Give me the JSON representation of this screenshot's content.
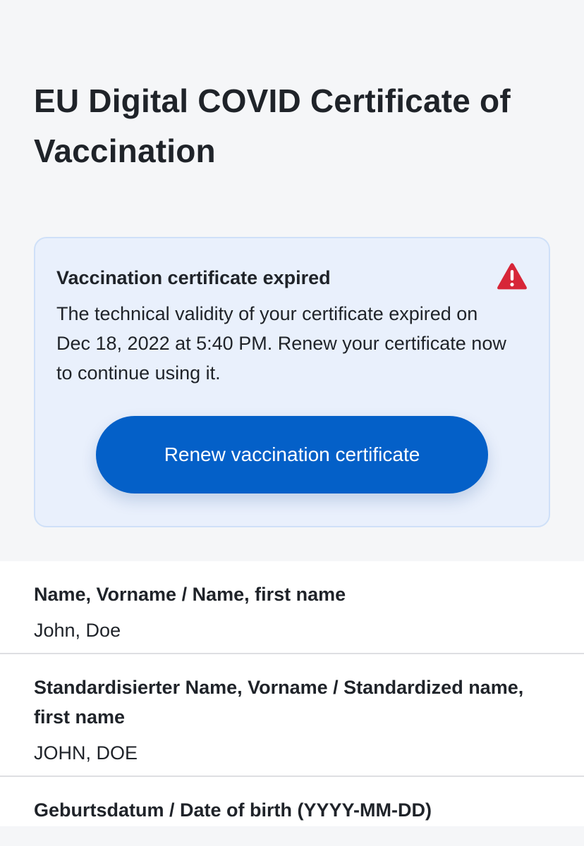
{
  "page": {
    "title": "EU Digital COVID Certificate of Vaccination"
  },
  "alert": {
    "title": "Vaccination certificate expired",
    "icon": "warning-triangle-icon",
    "icon_color": "#d72638",
    "body": "The technical validity of your certificate expired on Dec 18, 2022 at 5:40 PM. Renew your certificate now to continue using it.",
    "button_label": "Renew vaccination certificate",
    "button_color": "#0460c8"
  },
  "fields": [
    {
      "label": "Name, Vorname / Name, first name",
      "value": "John, Doe"
    },
    {
      "label": "Standardisierter Name, Vorname / Standardized name, first name",
      "value": "JOHN, DOE"
    },
    {
      "label": "Geburtsdatum / Date of birth (YYYY-MM-DD)",
      "value": ""
    }
  ]
}
